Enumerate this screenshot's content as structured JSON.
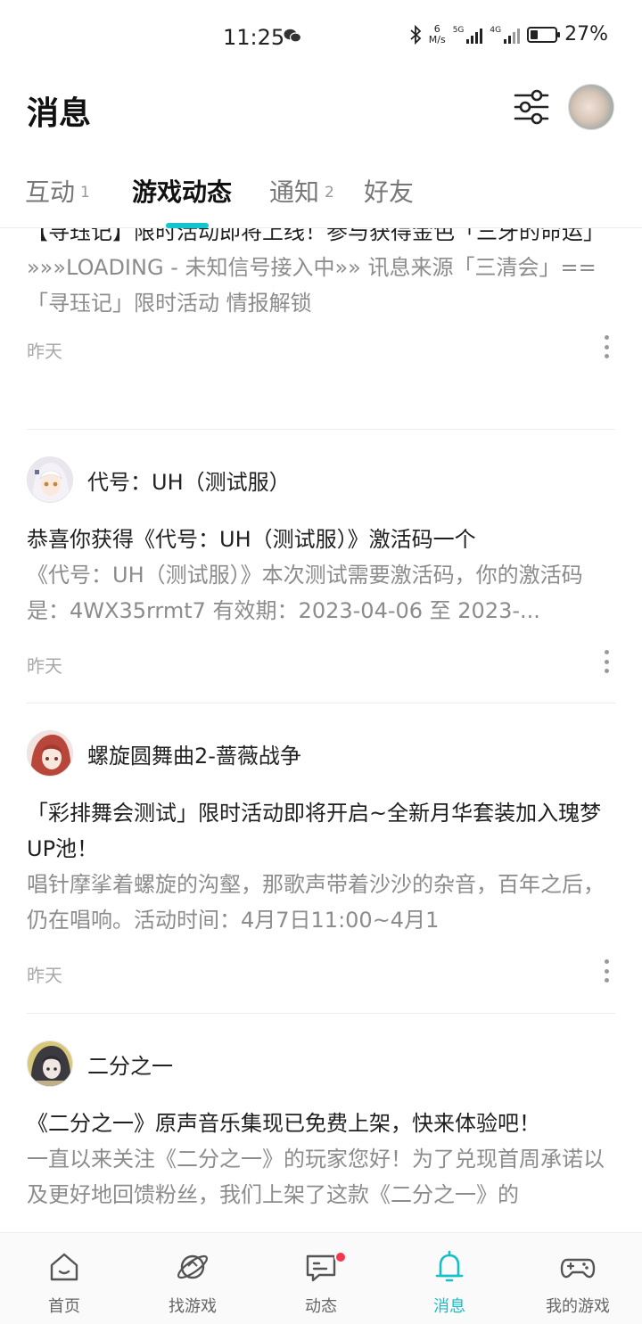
{
  "status_bar": {
    "time": "11:25",
    "net_speed_value": "6",
    "net_speed_unit": "M/s",
    "sig1_tag": "5G",
    "sig2_tag": "4G",
    "battery": "27%"
  },
  "header": {
    "title": "消息"
  },
  "tabs": [
    {
      "label": "互动",
      "count": "1"
    },
    {
      "label": "游戏动态",
      "count": ""
    },
    {
      "label": "通知",
      "count": "2"
    },
    {
      "label": "好友",
      "count": ""
    }
  ],
  "feed": {
    "items": [
      {
        "game": "",
        "title": "【寻珏记】限时活动即将上线！参与获得金色「三牙的命运」",
        "body": "»»»LOADING - 未知信号接入中»» 讯息来源「三清会」== 「寻珏记」限时活动 情报解锁",
        "time": "昨天"
      },
      {
        "game": "代号：UH（测试服）",
        "title": "恭喜你获得《代号：UH（测试服）》激活码一个",
        "body": "《代号：UH（测试服）》本次测试需要激活码，你的激活码是：4WX35rrmt7 有效期：2023-04-06 至 2023-...",
        "time": "昨天"
      },
      {
        "game": "螺旋圆舞曲2-蔷薇战争",
        "title": "「彩排舞会测试」限时活动即将开启~全新月华套装加入瑰梦UP池！",
        "body": "唱针摩挲着螺旋的沟壑，那歌声带着沙沙的杂音，百年之后，仍在唱响。活动时间：4月7日11:00~4月1",
        "time": "昨天"
      },
      {
        "game": "二分之一",
        "title": "《二分之一》原声音乐集现已免费上架，快来体验吧！",
        "body": "一直以来关注《二分之一》的玩家您好！为了兑现首周承诺以及更好地回馈粉丝，我们上架了这款《二分之一》的",
        "time": ""
      }
    ]
  },
  "bottom_nav": [
    {
      "label": "首页",
      "icon": "home-icon"
    },
    {
      "label": "找游戏",
      "icon": "planet-icon"
    },
    {
      "label": "动态",
      "icon": "chat-icon"
    },
    {
      "label": "消息",
      "icon": "bell-icon"
    },
    {
      "label": "我的游戏",
      "icon": "gamepad-icon"
    }
  ],
  "colors": {
    "accent": "#15c5ce",
    "badge_red": "#f2384a",
    "secondary_text": "#8c8c8c"
  }
}
